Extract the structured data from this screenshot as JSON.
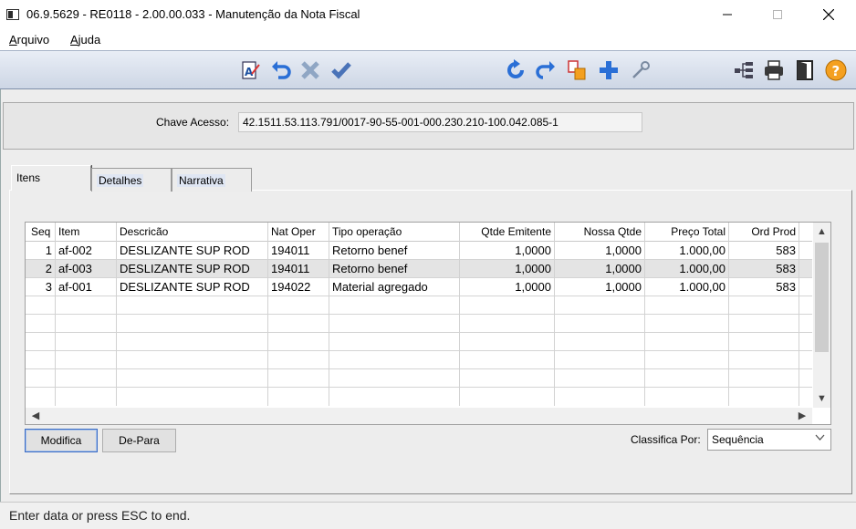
{
  "window": {
    "title": "06.9.5629 - RE0118 - 2.00.00.033 - Manutenção da Nota Fiscal",
    "minimize": "—",
    "maximize": "☐",
    "close": "✕"
  },
  "menu": [
    {
      "label_u": "A",
      "label_rest": "rquivo"
    },
    {
      "label_u": "A",
      "label_rest": "juda"
    }
  ],
  "toolbar": {
    "icons": [
      "edit-document-icon",
      "undo-icon",
      "cancel-icon",
      "confirm-icon",
      "refresh-icon",
      "redo-icon",
      "copy-icon",
      "add-icon",
      "tools-icon",
      "hierarchy-icon",
      "print-icon",
      "exit-door-icon",
      "help-icon"
    ]
  },
  "header": {
    "key_label": "Chave Acesso:",
    "key_value": "42.1511.53.113.791/0017-90-55-001-000.230.210-100.042.085-1"
  },
  "tabs": [
    {
      "label": "Itens",
      "active": true
    },
    {
      "label": "Detalhes",
      "active": false
    },
    {
      "label": "Narrativa",
      "active": false
    }
  ],
  "grid": {
    "columns": [
      "Seq",
      "Item",
      "Descricão",
      "Nat Oper",
      "Tipo operação",
      "Qtde Emitente",
      "Nossa Qtde",
      "Preço Total",
      "Ord Prod"
    ],
    "rows": [
      [
        "1",
        "af-002",
        "DESLIZANTE SUP ROD",
        "194011",
        "Retorno benef",
        "1,0000",
        "1,0000",
        "1.000,00",
        "583"
      ],
      [
        "2",
        "af-003",
        "DESLIZANTE SUP ROD",
        "194011",
        "Retorno benef",
        "1,0000",
        "1,0000",
        "1.000,00",
        "583"
      ],
      [
        "3",
        "af-001",
        "DESLIZANTE SUP ROD",
        "194022",
        "Material agregado",
        "1,0000",
        "1,0000",
        "1.000,00",
        "583"
      ]
    ],
    "selected_row": 2,
    "scroll_up": "▲",
    "scroll_down": "▼",
    "scroll_left": "◀",
    "scroll_right": "▶"
  },
  "buttons": {
    "modifica": "Modifica",
    "de_para": "De-Para"
  },
  "sort": {
    "label": "Classifica Por:",
    "value": "Sequência"
  },
  "status": {
    "text": "Enter data or press ESC to end."
  },
  "colors": {
    "toolbar_bg": "#cdd6e5",
    "icon_blue": "#2a6fd6",
    "icon_orange": "#f4a020",
    "selected_row": "#e4e4e4"
  }
}
